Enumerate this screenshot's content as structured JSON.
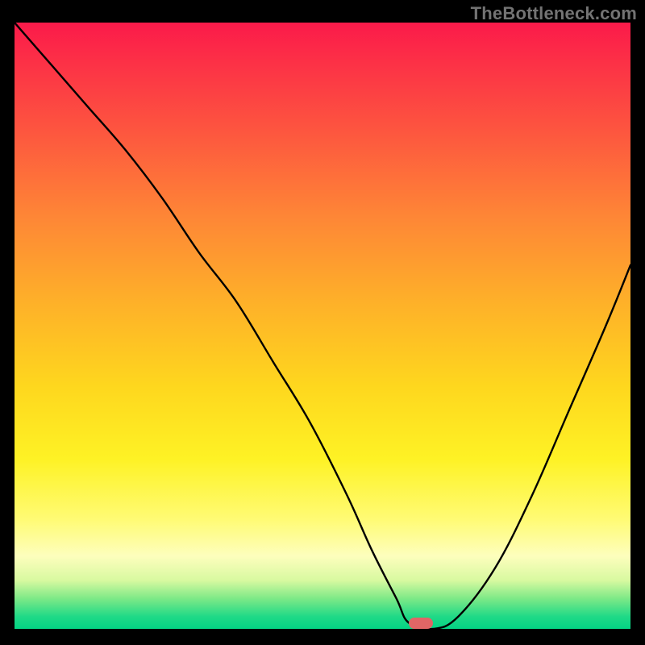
{
  "watermark": "TheBottleneck.com",
  "chart_data": {
    "type": "line",
    "title": "",
    "xlabel": "",
    "ylabel": "",
    "xlim": [
      0,
      100
    ],
    "ylim": [
      0,
      100
    ],
    "grid": false,
    "legend": false,
    "background_gradient": {
      "stops": [
        {
          "pos": 0,
          "color": "#fb1a4a"
        },
        {
          "pos": 18,
          "color": "#fd563f"
        },
        {
          "pos": 46,
          "color": "#feb029"
        },
        {
          "pos": 72,
          "color": "#fef225"
        },
        {
          "pos": 88,
          "color": "#fdfebd"
        },
        {
          "pos": 95,
          "color": "#7de987"
        },
        {
          "pos": 100,
          "color": "#04d384"
        }
      ]
    },
    "series": [
      {
        "name": "bottleneck-curve",
        "x": [
          0,
          6,
          12,
          18,
          24,
          30,
          36,
          42,
          48,
          54,
          58,
          62,
          64,
          68,
          72,
          78,
          84,
          90,
          96,
          100
        ],
        "values": [
          100,
          93,
          86,
          79,
          71,
          62,
          54,
          44,
          34,
          22,
          13,
          5,
          1,
          0,
          2,
          10,
          22,
          36,
          50,
          60
        ]
      }
    ],
    "marker": {
      "x": 66,
      "y": 0,
      "color": "#e06666"
    }
  }
}
